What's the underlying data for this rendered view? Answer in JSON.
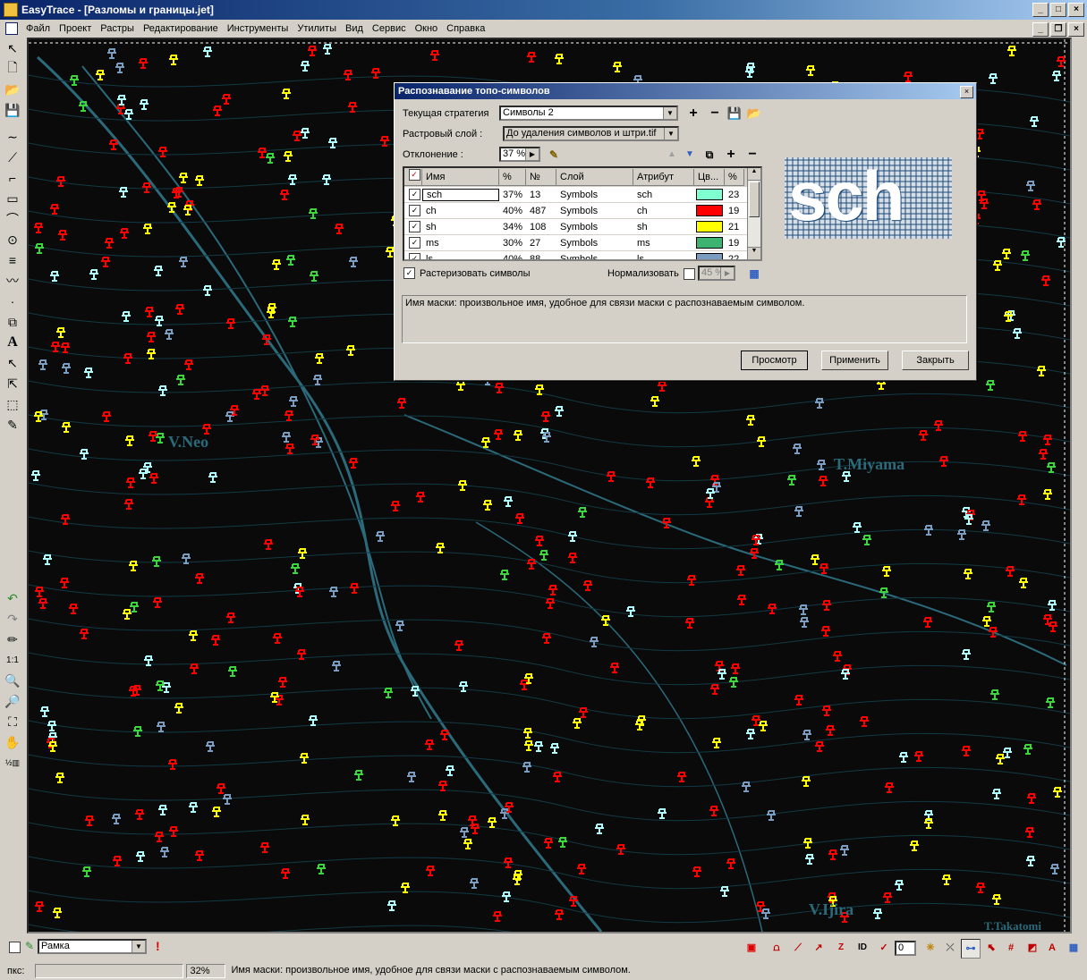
{
  "window": {
    "title": "EasyTrace - [Разломы и границы.jet]"
  },
  "menu": [
    "Файл",
    "Проект",
    "Растры",
    "Редактирование",
    "Инструменты",
    "Утилиты",
    "Вид",
    "Сервис",
    "Окно",
    "Справка"
  ],
  "map": {
    "labels": [
      {
        "text": "V.Neo"
      },
      {
        "text": "T.Miyama"
      },
      {
        "text": "V.Ijira"
      },
      {
        "text": "T.Takatomi"
      }
    ],
    "colors": {
      "red": "#ff0000",
      "yellow": "#ffff00",
      "cyan": "#b0ffff",
      "blue": "#7a9cc0",
      "green": "#3bd63b",
      "teal": "#2b6a7a"
    }
  },
  "dialog": {
    "title": "Распознавание топо-символов",
    "strategy_label": "Текущая стратегия",
    "strategy_value": "Символы 2",
    "raster_label": "Растровый слой :",
    "raster_value": "До удаления символов и штри.tif",
    "deviation_label": "Отклонение :",
    "deviation_value": "37 %",
    "table": {
      "headers": [
        "Имя",
        "%",
        "№",
        "Слой",
        "Атрибут",
        "Цв...",
        "%"
      ],
      "rows": [
        {
          "checked": true,
          "name": "sch",
          "pct": "37%",
          "num": "13",
          "layer": "Symbols",
          "attr": "sch",
          "color": "#80ffd0",
          "pct2": "23"
        },
        {
          "checked": true,
          "name": "ch",
          "pct": "40%",
          "num": "487",
          "layer": "Symbols",
          "attr": "ch",
          "color": "#ff0000",
          "pct2": "19"
        },
        {
          "checked": true,
          "name": "sh",
          "pct": "34%",
          "num": "108",
          "layer": "Symbols",
          "attr": "sh",
          "color": "#ffff00",
          "pct2": "21"
        },
        {
          "checked": true,
          "name": "ms",
          "pct": "30%",
          "num": "27",
          "layer": "Symbols",
          "attr": "ms",
          "color": "#3cb371",
          "pct2": "19"
        },
        {
          "checked": true,
          "name": "ls",
          "pct": "40%",
          "num": "88",
          "layer": "Symbols",
          "attr": "ls",
          "color": "#7a9cc0",
          "pct2": "22"
        }
      ]
    },
    "preview_text": "sch",
    "rasterize_label": "Растеризовать символы",
    "normalize_label": "Нормализовать",
    "normalize_value": "45 %",
    "description": "Имя маски: произвольное имя, удобное для связи маски с распознаваемым символом.",
    "buttons": {
      "preview": "Просмотр",
      "apply": "Применить",
      "close": "Закрыть"
    }
  },
  "status": {
    "layer_value": "Рамка",
    "pix_label": "пкс:",
    "zoom": "32%",
    "message": "Имя маски: произвольное имя, удобное для связи маски с распознаваемым символом.",
    "counter": "0"
  }
}
